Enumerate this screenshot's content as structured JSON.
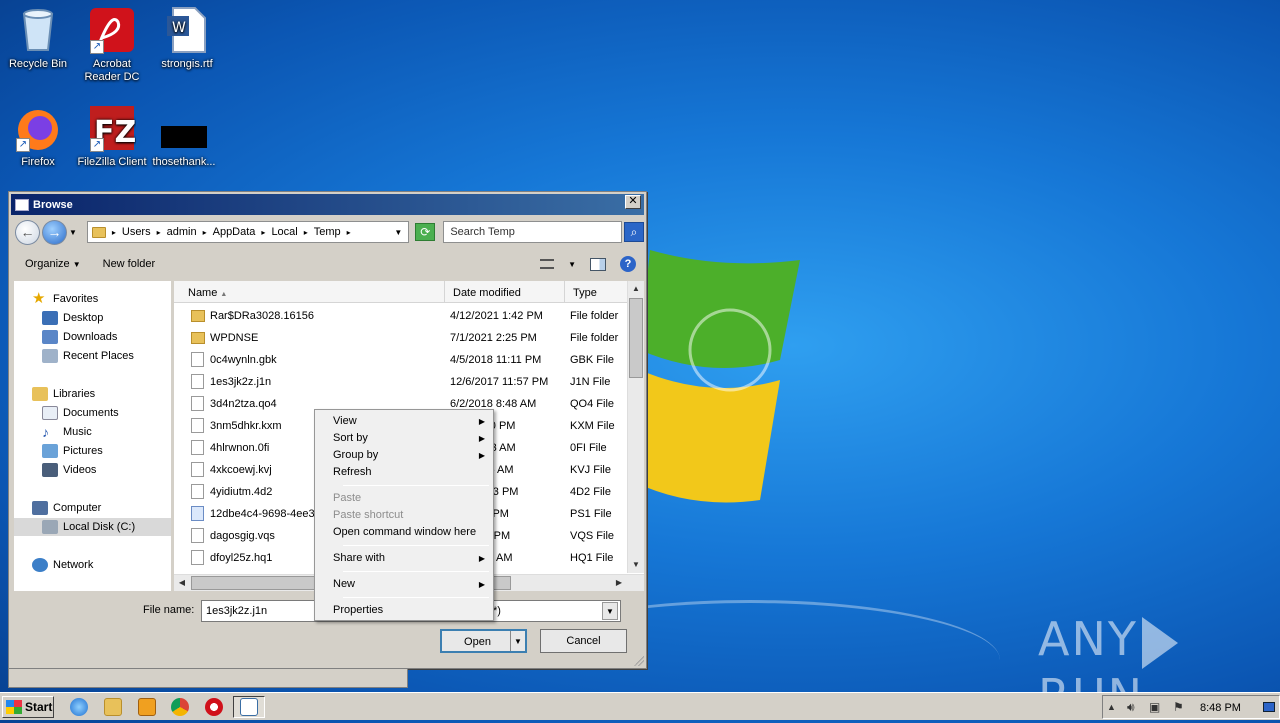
{
  "desktop": {
    "icons": [
      {
        "label": "Recycle Bin"
      },
      {
        "label": "Acrobat Reader DC"
      },
      {
        "label": "strongis.rtf"
      },
      {
        "label": "Firefox"
      },
      {
        "label": "FileZilla Client"
      },
      {
        "label": "thosethank..."
      }
    ],
    "watermark": "ANY RUN"
  },
  "dialog": {
    "title": "Browse",
    "breadcrumbs": [
      "Users",
      "admin",
      "AppData",
      "Local",
      "Temp"
    ],
    "search_placeholder": "Search Temp",
    "toolbar": {
      "organize": "Organize",
      "new_folder": "New folder"
    },
    "nav": {
      "favorites": "Favorites",
      "desktop": "Desktop",
      "downloads": "Downloads",
      "recent": "Recent Places",
      "libraries": "Libraries",
      "documents": "Documents",
      "music": "Music",
      "pictures": "Pictures",
      "videos": "Videos",
      "computer": "Computer",
      "local_disk": "Local Disk (C:)",
      "network": "Network"
    },
    "columns": {
      "name": "Name",
      "date": "Date modified",
      "type": "Type"
    },
    "files": [
      {
        "name": "Rar$DRa3028.16156",
        "date": "4/12/2021 1:42 PM",
        "type": "File folder"
      },
      {
        "name": "WPDNSE",
        "date": "7/1/2021 2:25 PM",
        "type": "File folder"
      },
      {
        "name": "0c4wynln.gbk",
        "date": "4/5/2018 11:11 PM",
        "type": "GBK File"
      },
      {
        "name": "1es3jk2z.j1n",
        "date": "12/6/2017 11:57 PM",
        "type": "J1N File"
      },
      {
        "name": "3d4n2tza.qo4",
        "date": "6/2/2018 8:48 AM",
        "type": "QO4 File"
      },
      {
        "name": "3nm5dhkr.kxm",
        "date": "9 11:30 PM",
        "type": "KXM File"
      },
      {
        "name": "4hlrwnon.0fi",
        "date": "19 1:03 AM",
        "type": "0FI File"
      },
      {
        "name": "4xkcoewj.kvj",
        "date": "1 4:55 AM",
        "type": "KVJ File"
      },
      {
        "name": "4yidiutm.4d2",
        "date": "0 11:03 PM",
        "type": "4D2 File"
      },
      {
        "name": "12dbe4c4-9698-4ee3-",
        "date": "2:41 PM",
        "type": "PS1 File"
      },
      {
        "name": "dagosgig.vqs",
        "date": "9 4:52 PM",
        "type": "VQS File"
      },
      {
        "name": "dfoyl25z.hq1",
        "date": "1 7:07 AM",
        "type": "HQ1 File"
      }
    ],
    "file_name_label": "File name:",
    "file_name_value": "1es3jk2z.j1n",
    "filter_fragment": "*)",
    "open_label": "Open",
    "cancel_label": "Cancel"
  },
  "context_menu": {
    "view": "View",
    "sort_by": "Sort by",
    "group_by": "Group by",
    "refresh": "Refresh",
    "paste": "Paste",
    "paste_shortcut": "Paste shortcut",
    "open_cmd": "Open command window here",
    "share_with": "Share with",
    "new": "New",
    "properties": "Properties"
  },
  "taskbar": {
    "start": "Start",
    "clock": "8:48 PM"
  }
}
